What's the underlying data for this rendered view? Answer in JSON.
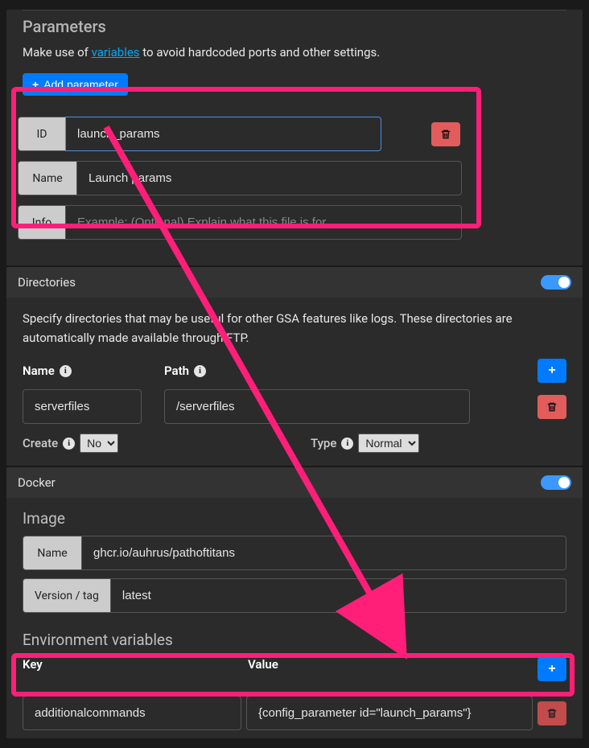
{
  "parameters": {
    "title": "Parameters",
    "desc_before": "Make use of ",
    "desc_link": "variables",
    "desc_after": " to avoid hardcoded ports and other settings.",
    "add_label": "Add parameter",
    "rows": [
      {
        "id_label": "ID",
        "id_value": "launch_params",
        "name_label": "Name",
        "name_value": "Launch params",
        "info_label": "Info",
        "info_placeholder": "Example: (Optional) Explain what this file is for..."
      }
    ]
  },
  "directories": {
    "title": "Directories",
    "desc": "Specify directories that may be useful for other GSA features like logs. These directories are automatically made available through FTP.",
    "labels": {
      "name": "Name",
      "path": "Path"
    },
    "rows": [
      {
        "name": "serverfiles",
        "path": "/serverfiles"
      }
    ],
    "create_label": "Create",
    "create_value": "No",
    "type_label": "Type",
    "type_value": "Normal"
  },
  "docker": {
    "title": "Docker",
    "image_title": "Image",
    "fields": {
      "name_label": "Name",
      "name_value": "ghcr.io/auhrus/pathoftitans",
      "version_label": "Version / tag",
      "version_value": "latest"
    },
    "env_title": "Environment variables",
    "env_labels": {
      "key": "Key",
      "value": "Value"
    },
    "env_rows": [
      {
        "key": "additionalcommands",
        "value": "{config_parameter id=\"launch_params\"}"
      }
    ]
  },
  "icons": {
    "plus": "+",
    "info": "i"
  }
}
